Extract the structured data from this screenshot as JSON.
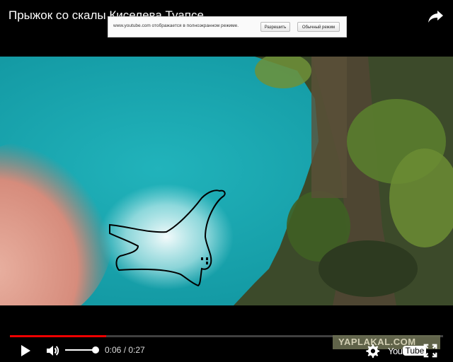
{
  "video": {
    "title": "Прыжок со скалы Киселева Туапсе",
    "current_time": "0:06",
    "duration": "0:27",
    "time_display": "0:06 / 0:27",
    "progress_fraction": 0.222,
    "volume_fraction": 1.0
  },
  "fullscreen_notice": {
    "message": "www.youtube.com отображается в полноэкранном режиме.",
    "allow_label": "Разрешить",
    "normal_label": "Обычный режим"
  },
  "watermark": {
    "text": "YAPLAKAL.COM"
  },
  "logo": {
    "you": "You",
    "tube": "Tube"
  },
  "icons": {
    "share": "share-icon",
    "play": "play-icon",
    "mute": "volume-icon",
    "settings": "gear-icon",
    "fullscreen": "fullscreen-icon"
  },
  "colors": {
    "progress": "#ee0000",
    "water": "#1aa6b0",
    "player_bg": "#000000"
  }
}
